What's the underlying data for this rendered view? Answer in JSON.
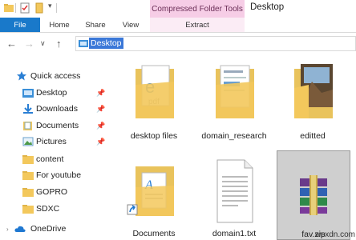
{
  "window": {
    "title": "Desktop",
    "context_tab_group": "Compressed Folder Tools"
  },
  "ribbon": {
    "tabs": [
      "File",
      "Home",
      "Share",
      "View",
      "Extract"
    ]
  },
  "address": {
    "path": "Desktop"
  },
  "nav": {
    "items": [
      {
        "label": "Quick access",
        "icon": "star-icon",
        "pinned": false
      },
      {
        "label": "Desktop",
        "icon": "folder-blue-icon",
        "pinned": true
      },
      {
        "label": "Downloads",
        "icon": "download-icon",
        "pinned": true
      },
      {
        "label": "Documents",
        "icon": "documents-icon",
        "pinned": true
      },
      {
        "label": "Pictures",
        "icon": "pictures-icon",
        "pinned": true
      },
      {
        "label": "content",
        "icon": "folder-icon",
        "pinned": false
      },
      {
        "label": "For youtube",
        "icon": "folder-icon",
        "pinned": false
      },
      {
        "label": "GOPRO",
        "icon": "folder-icon",
        "pinned": false
      },
      {
        "label": "SDXC",
        "icon": "folder-icon",
        "pinned": false
      },
      {
        "label": "OneDrive",
        "icon": "cloud-icon",
        "pinned": false
      }
    ]
  },
  "files": [
    {
      "name": "desktop files",
      "icon": "folder-with-docs-icon"
    },
    {
      "name": "domain_research",
      "icon": "folder-with-docs-icon"
    },
    {
      "name": "editted",
      "icon": "folder-with-photo-icon"
    },
    {
      "name": "Documents",
      "icon": "documents-shortcut-icon"
    },
    {
      "name": "domain1.txt",
      "icon": "text-file-icon"
    },
    {
      "name": "fav.zip",
      "icon": "winrar-archive-icon",
      "selected": true
    }
  ],
  "watermark": "wsxdn.com",
  "colors": {
    "accent": "#1979ca",
    "context_tab": "#f6cde6",
    "selection": "#3b78d8",
    "folder": "#f3c85c"
  }
}
